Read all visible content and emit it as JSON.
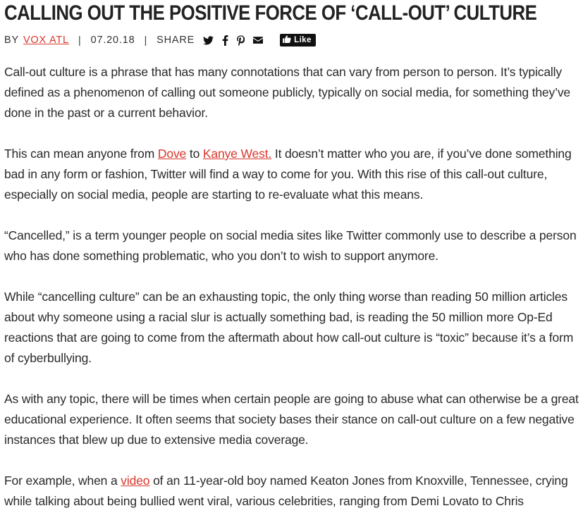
{
  "article": {
    "title": "CALLING OUT THE POSITIVE FORCE OF ‘CALL-OUT’ CULTURE",
    "byline": {
      "by_label": "BY",
      "author": "VOX ATL",
      "date": "07.20.18",
      "share_label": "SHARE",
      "share_icons": [
        "twitter-icon",
        "facebook-icon",
        "pinterest-icon",
        "email-icon"
      ],
      "like_label": "Like"
    },
    "paragraphs": [
      {
        "text": "Call-out culture is a phrase that has many connotations that can vary from person to person. It’s typically defined as a phenomenon of calling out someone publicly, typically on social media, for something they’ve done in the past or a current behavior."
      },
      {
        "p1": "This can mean anyone from ",
        "link1": "Dove",
        "p2": " to ",
        "link2": "Kanye West.",
        "p3": " It doesn’t matter who you are, if you’ve done something bad in any form or fashion, Twitter will find a way to come for you. With this rise of this call-out culture, especially on social media, people are starting to re-evaluate what this means."
      },
      {
        "text": "“Cancelled,” is a term younger people on social media sites like Twitter commonly use to describe a person who has done something problematic, who you don’t to wish to support anymore."
      },
      {
        "text": "While “cancelling culture” can be an exhausting topic, the only thing worse than reading 50 million articles about why someone using a racial slur is actually something bad, is reading the 50 million more Op-Ed reactions that are going to come from the aftermath about how call-out culture is “toxic” because it’s a form of cyberbullying."
      },
      {
        "text": "As with any topic, there will be times when certain people are going to abuse what can otherwise be a great educational experience. It often seems that society bases their stance on call-out culture on a few negative instances that blew up due to extensive media coverage."
      },
      {
        "p1": "For example, when a ",
        "link1": "video",
        "p2": " of an 11-year-old boy named Keaton Jones from Knoxville, Tennessee, crying while talking about being bullied went viral, various celebrities, ranging from Demi Lovato to Chris"
      }
    ],
    "link_color": "#d9362b"
  }
}
